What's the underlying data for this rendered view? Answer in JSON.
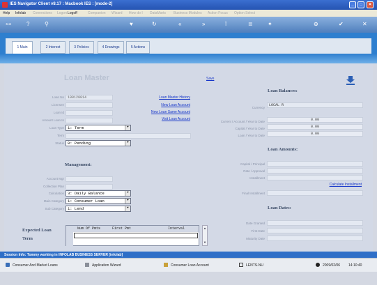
{
  "window": {
    "title": "IES Navigator Client v8.17 : Macbook IES :     [mode-2]",
    "minimize": "_",
    "maximize": "□",
    "close": "✕"
  },
  "menu": {
    "items": [
      {
        "label": "Help",
        "enabled": true
      },
      {
        "label": "Infolab",
        "enabled": true
      },
      {
        "label": "Connections",
        "enabled": false
      },
      {
        "label": "Logon",
        "enabled": false
      },
      {
        "label": "Logoff",
        "enabled": true
      },
      {
        "label": "Companion",
        "enabled": false
      },
      {
        "label": "Wizard",
        "enabled": false
      },
      {
        "label": "How do I",
        "enabled": false
      },
      {
        "label": "DataMarts",
        "enabled": false
      },
      {
        "label": "Business Modules",
        "enabled": false
      },
      {
        "label": "Action Focus",
        "enabled": false
      },
      {
        "label": "Option Select",
        "enabled": false
      }
    ]
  },
  "tabs": [
    {
      "label": "1 Main"
    },
    {
      "label": "2 Interest"
    },
    {
      "label": "3 Policies"
    },
    {
      "label": "4 Drawings"
    },
    {
      "label": "5 Actions"
    }
  ],
  "page": {
    "title": "Loan Master",
    "save": "Save"
  },
  "left": {
    "loan_no_label": "Loan No",
    "loan_no_value": "100120014",
    "licensee_label": "Licensee",
    "loan_label": "Loan Id",
    "amount_label": "Amount Loan In",
    "loan_type_label": "Loan Type",
    "loan_type_value": "1: Term",
    "term_label": "Term",
    "status_label": "Status",
    "status_value": "0: Pending",
    "links": [
      "Loan Master History",
      "New Loan Account",
      "New Loan Same Account",
      "Visit Loan Account"
    ]
  },
  "management": {
    "heading": "Management:",
    "account_mgr_label": "Account Mgr",
    "collection_plan_label": "Collection Plan",
    "calculation_label": "Calculation",
    "calculation_value": "3: Daily Balance",
    "main_category_label": "Main Category",
    "main_category_value": "1: Consumer Loan",
    "sub_category_label": "Sub Category",
    "sub_category_value": "1: Lend"
  },
  "expected_term": {
    "heading_line1": "Expected Loan",
    "heading_line2": "Term",
    "col_num": "Num Of Pmts",
    "col_first": "First Pmt",
    "col_interval": "Interval"
  },
  "balances": {
    "heading": "Loan Balances:",
    "currency_label": "Currency",
    "currency_value": "LOCAL R",
    "current_label": "Current / Account / Year to Date",
    "current_value": "0.00",
    "capital_label": "Capital / Year to Date",
    "capital_value": "0.00",
    "interest_label": "Loan / Year to Date",
    "interest_value": "0.00"
  },
  "amounts": {
    "heading": "Loan Amounts:",
    "capital_label": "Capital / Principal",
    "rate_label": "Rate / Approval",
    "installment_label": "Installment",
    "calc_link": "Calculate Installment",
    "final_label": "Final Installment"
  },
  "dates": {
    "heading": "Loan Dates:",
    "date_granted_label": "Date Granted",
    "first_date_label": "First Date",
    "maturity_label": "Maturity Date"
  },
  "status_bar": {
    "text": "Session Info: Tommy working in INFOLAB BUSINESS SERVER   [infolab]"
  },
  "taskbar": {
    "item1": "Consumer And Market Loans",
    "item2": "Application Wizard",
    "item3": "Consumer Loan Account",
    "item4": "LENTS-NU",
    "date": "2009/02/06",
    "time": "14:10:40"
  },
  "colors": {
    "accent": "#2e7fcf",
    "title": "#2554b3",
    "link": "#1535c9"
  }
}
